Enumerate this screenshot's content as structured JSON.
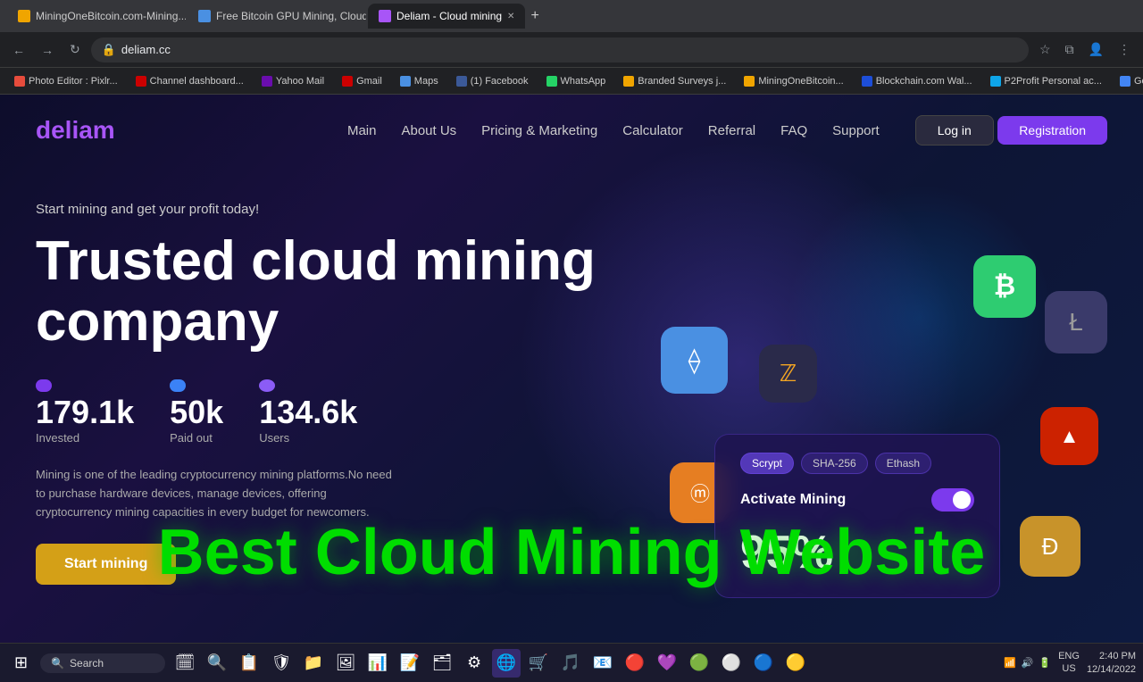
{
  "browser": {
    "tabs": [
      {
        "label": "MiningOneBitcoin.com-Mining...",
        "favicon_color": "#f0a500",
        "active": false
      },
      {
        "label": "Free Bitcoin GPU Mining, Cloud...",
        "favicon_color": "#4a90e2",
        "active": false
      },
      {
        "label": "Deliam - Cloud mining",
        "favicon_color": "#a855f7",
        "active": true
      }
    ],
    "address": "deliam.cc",
    "new_tab_label": "+"
  },
  "bookmarks": [
    {
      "label": "Photo Editor : Pixlr...",
      "color": "#e74c3c"
    },
    {
      "label": "Channel dashboard...",
      "color": "#cc0000"
    },
    {
      "label": "Yahoo Mail",
      "color": "#6a0dad"
    },
    {
      "label": "Gmail",
      "color": "#cc0000"
    },
    {
      "label": "Maps",
      "color": "#4a90e2"
    },
    {
      "label": "(1) Facebook",
      "color": "#3b5998"
    },
    {
      "label": "WhatsApp",
      "color": "#25d366"
    },
    {
      "label": "Branded Surveys j...",
      "color": "#f0a500"
    },
    {
      "label": "MiningOneBitcoin...",
      "color": "#f0a500"
    },
    {
      "label": "Blockchain.com Wal...",
      "color": "#1d4ed8"
    },
    {
      "label": "P2Profit Personal ac...",
      "color": "#0ea5e9"
    },
    {
      "label": "Google AdSense",
      "color": "#4285f4"
    }
  ],
  "nav": {
    "logo": "deliam",
    "links": [
      "Main",
      "About Us",
      "Pricing & Marketing",
      "Calculator",
      "Referral",
      "FAQ",
      "Support"
    ],
    "login_label": "Log in",
    "register_label": "Registration"
  },
  "hero": {
    "subtitle": "Start mining and get your profit today!",
    "title": "Trusted cloud mining company",
    "stats": [
      {
        "value": "179.1k",
        "label": "Invested"
      },
      {
        "value": "50k",
        "label": "Paid out"
      },
      {
        "value": "134.6k",
        "label": "Users"
      }
    ],
    "description": "Mining is one of the leading cryptocurrency mining platforms.No need to purchase hardware devices, manage devices, offering cryptocurrency mining capacities in every budget for newcomers.",
    "cta_label": "Start mining"
  },
  "mining_card": {
    "tabs": [
      "Scrypt",
      "SHA-256",
      "Ethash"
    ],
    "active_tab": "Scrypt",
    "activate_label": "Activate Mining",
    "percent": "95%"
  },
  "overlay": {
    "text": "Best Cloud Mining Website"
  },
  "crypto_icons": {
    "btc": "₿",
    "eth": "⟠",
    "zcash": "ℤ",
    "ltc": "Ł",
    "tron": "▲",
    "monero": "ⓜ",
    "dogecoin": "Ð"
  },
  "taskbar": {
    "start_icon": "⊞",
    "search_text": "Search",
    "time": "2:40 PM",
    "date": "12/14/2022",
    "language": "ENG\nUS",
    "apps": [
      "🗓",
      "🔍",
      "📋",
      "🛡",
      "📁",
      "🖼",
      "📊",
      "📝",
      "🗂",
      "⚙"
    ]
  }
}
